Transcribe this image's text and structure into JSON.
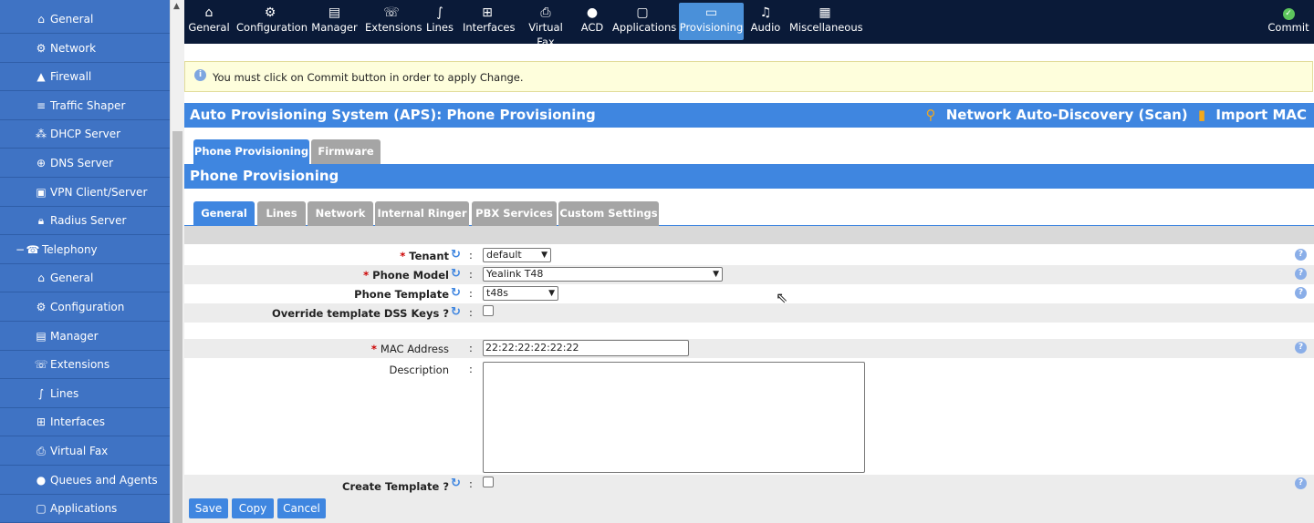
{
  "sidebar": {
    "items": [
      {
        "label": "General",
        "icon": "home-icon",
        "glyph": "⌂"
      },
      {
        "label": "Network",
        "icon": "gear-icon",
        "glyph": "⚙"
      },
      {
        "label": "Firewall",
        "icon": "firewall-icon",
        "glyph": "▲"
      },
      {
        "label": "Traffic Shaper",
        "icon": "traffic-shaper-icon",
        "glyph": "≡"
      },
      {
        "label": "DHCP Server",
        "icon": "dhcp-icon",
        "glyph": "⁂"
      },
      {
        "label": "DNS Server",
        "icon": "globe-icon",
        "glyph": "⊕"
      },
      {
        "label": "VPN Client/Server",
        "icon": "vpn-icon",
        "glyph": "▣"
      },
      {
        "label": "Radius Server",
        "icon": "lock-icon",
        "glyph": "🔒︎"
      }
    ],
    "group": {
      "label": "Telephony",
      "toggle": "−",
      "icon": "telephony-icon",
      "glyph": "☎"
    },
    "sub_items": [
      {
        "label": "General",
        "icon": "home-icon",
        "glyph": "⌂"
      },
      {
        "label": "Configuration",
        "icon": "gear-icon",
        "glyph": "⚙"
      },
      {
        "label": "Manager",
        "icon": "manager-icon",
        "glyph": "▤"
      },
      {
        "label": "Extensions",
        "icon": "extensions-icon",
        "glyph": "☏"
      },
      {
        "label": "Lines",
        "icon": "lines-icon",
        "glyph": "∫"
      },
      {
        "label": "Interfaces",
        "icon": "interfaces-icon",
        "glyph": "⊞"
      },
      {
        "label": "Virtual Fax",
        "icon": "fax-icon",
        "glyph": "⎙"
      },
      {
        "label": "Queues and Agents",
        "icon": "agent-icon",
        "glyph": "●"
      },
      {
        "label": "Applications",
        "icon": "applications-icon",
        "glyph": "▢"
      }
    ]
  },
  "topnav": {
    "items": [
      {
        "label": "General",
        "icon": "home-icon",
        "glyph": "⌂"
      },
      {
        "label": "Configuration",
        "icon": "gear-icon",
        "glyph": "⚙"
      },
      {
        "label": "Manager",
        "icon": "manager-icon",
        "glyph": "▤"
      },
      {
        "label": "Extensions",
        "icon": "extensions-icon",
        "glyph": "☏"
      },
      {
        "label": "Lines",
        "icon": "lines-icon",
        "glyph": "∫"
      },
      {
        "label": "Interfaces",
        "icon": "interfaces-icon",
        "glyph": "⊞"
      },
      {
        "label": "Virtual Fax",
        "icon": "fax-icon",
        "glyph": "⎙"
      },
      {
        "label": "ACD",
        "icon": "agent-icon",
        "glyph": "●"
      },
      {
        "label": "Applications",
        "icon": "applications-icon",
        "glyph": "▢"
      },
      {
        "label": "Provisioning",
        "icon": "provisioning-icon",
        "glyph": "▭",
        "active": true
      },
      {
        "label": "Audio",
        "icon": "music-icon",
        "glyph": "♫"
      },
      {
        "label": "Miscellaneous",
        "icon": "grid-icon",
        "glyph": "▦"
      }
    ],
    "commit_label": "Commit",
    "commit_glyph": "✓"
  },
  "notice": {
    "info_glyph": "i",
    "text": "You must click on Commit button in order to apply Change."
  },
  "aps": {
    "title": "Auto Provisioning System (APS):  Phone Provisioning",
    "scan_label": "Network Auto-Discovery (Scan)",
    "scan_glyph": "⚲",
    "import_label": "Import MAC",
    "import_glyph": "▮"
  },
  "tabs_top": [
    "Phone Provisioning",
    "Firmware"
  ],
  "section_title": "Phone Provisioning",
  "tabs_sub": [
    "General",
    "Lines",
    "Network",
    "Internal Ringer",
    "PBX Services",
    "Custom Settings"
  ],
  "form": {
    "required_mark": "*",
    "colon": ":",
    "sync_glyph": "↻",
    "help_glyph": "?",
    "tenant": {
      "label": "Tenant",
      "value": "default"
    },
    "phone_model": {
      "label": "Phone Model",
      "value": "Yealink T48"
    },
    "phone_template": {
      "label": "Phone Template",
      "value": "t48s"
    },
    "override_dss": {
      "label": "Override template DSS Keys ?",
      "checked": false
    },
    "mac_address": {
      "label": "MAC Address",
      "value": "22:22:22:22:22:22"
    },
    "description": {
      "label": "Description",
      "value": ""
    },
    "create_template": {
      "label": "Create Template ?",
      "checked": false
    },
    "caret": "▼"
  },
  "buttons": {
    "save": "Save",
    "copy": "Copy",
    "cancel": "Cancel"
  },
  "colors": {
    "sidebar": "#3f73c4",
    "topnav": "#0a1a38",
    "accent": "#3f86e0",
    "tab_inactive": "#a5a5a5",
    "notice_bg": "#fefedc"
  }
}
